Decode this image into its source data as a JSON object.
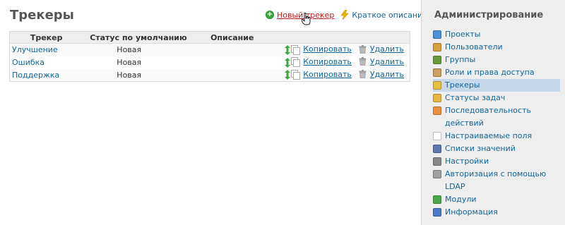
{
  "page": {
    "title": "Трекеры",
    "new_tracker_label": "Новый трекер",
    "summary_label": "Краткое описание"
  },
  "table": {
    "headers": [
      "Трекер",
      "Статус по умолчанию",
      "Описание"
    ],
    "copy_label": "Копировать",
    "delete_label": "Удалить",
    "rows": [
      {
        "name": "Улучшение",
        "status": "Новая",
        "description": ""
      },
      {
        "name": "Ошибка",
        "status": "Новая",
        "description": ""
      },
      {
        "name": "Поддержка",
        "status": "Новая",
        "description": ""
      }
    ]
  },
  "sidebar": {
    "title": "Администрирование",
    "items": [
      {
        "label": "Проекты",
        "icon": "projects-icon",
        "color": "#4a90d9"
      },
      {
        "label": "Пользователи",
        "icon": "users-icon",
        "color": "#d8a040"
      },
      {
        "label": "Группы",
        "icon": "groups-icon",
        "color": "#6a9a3a"
      },
      {
        "label": "Роли и права доступа",
        "icon": "roles-icon",
        "color": "#c8a060"
      },
      {
        "label": "Трекеры",
        "icon": "trackers-icon",
        "color": "#e8c040",
        "selected": true
      },
      {
        "label": "Статусы задач",
        "icon": "issue-statuses-icon",
        "color": "#e8b840"
      },
      {
        "label": "Последовательность действий",
        "icon": "workflow-icon",
        "color": "#e89040"
      },
      {
        "label": "Настраиваемые поля",
        "icon": "custom-fields-icon",
        "color": "#ffffff"
      },
      {
        "label": "Списки значений",
        "icon": "enumerations-icon",
        "color": "#5a7ab0"
      },
      {
        "label": "Настройки",
        "icon": "settings-icon",
        "color": "#888888"
      },
      {
        "label": "Авторизация с помощью LDAP",
        "icon": "ldap-icon",
        "color": "#a0a0a0"
      },
      {
        "label": "Модули",
        "icon": "plugins-icon",
        "color": "#4aa84a"
      },
      {
        "label": "Информация",
        "icon": "info-icon",
        "color": "#4a7ac8"
      }
    ]
  }
}
